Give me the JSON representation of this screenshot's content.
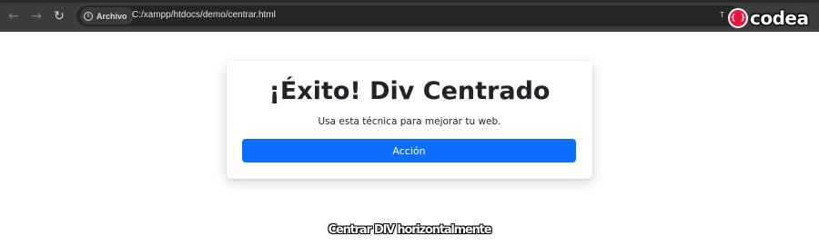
{
  "browser": {
    "back_icon": "arrow-left-icon",
    "forward_icon": "arrow-right-icon",
    "reload_icon": "reload-icon",
    "site_info_icon": "info-icon",
    "site_info_label": "Archivo",
    "url": "C:/xampp/htdocs/demo/centrar.html",
    "right_glyph": "T"
  },
  "logo": {
    "badge": "{ }",
    "text": "codea",
    "accent": "#e8173f"
  },
  "card": {
    "title": "¡Éxito! Div Centrado",
    "text": "Usa esta técnica para mejorar tu web.",
    "button_label": "Acción",
    "button_color": "#0d6efd"
  },
  "caption": "Centrar DIV horizontalmente"
}
